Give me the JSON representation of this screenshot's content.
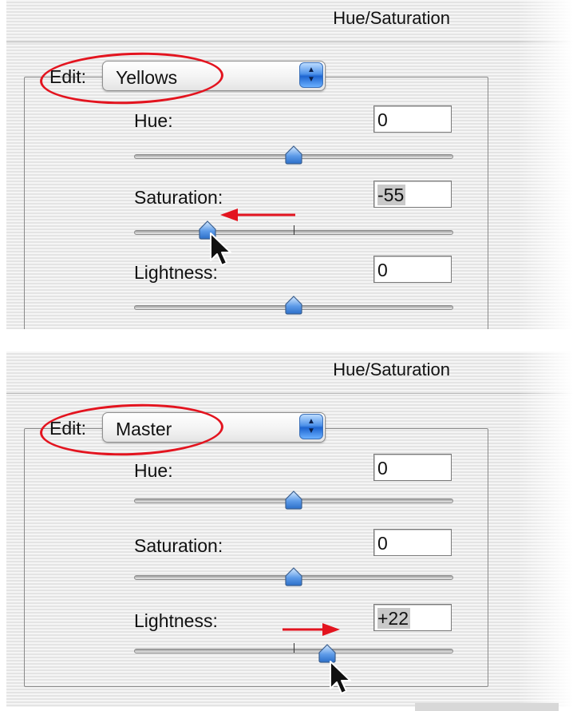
{
  "panels": [
    {
      "title": "Hue/Saturation",
      "edit_label": "Edit:",
      "edit_value": "Yellows",
      "sliders": {
        "hue": {
          "label": "Hue:",
          "value": "0"
        },
        "saturation": {
          "label": "Saturation:",
          "value": "-55"
        },
        "lightness": {
          "label": "Lightness:",
          "value": "0"
        }
      }
    },
    {
      "title": "Hue/Saturation",
      "edit_label": "Edit:",
      "edit_value": "Master",
      "sliders": {
        "hue": {
          "label": "Hue:",
          "value": "0"
        },
        "saturation": {
          "label": "Saturation:",
          "value": "0"
        },
        "lightness": {
          "label": "Lightness:",
          "value": "+22"
        }
      }
    }
  ],
  "colors": {
    "annotation_red": "#e3141f",
    "stepper_blue": "#2a72dc",
    "thumb_blue": "#5d9be8"
  },
  "icons": [
    "chevron-updown-icon",
    "slider-thumb-icon",
    "mouse-pointer-icon",
    "red-arrow-annotation"
  ]
}
